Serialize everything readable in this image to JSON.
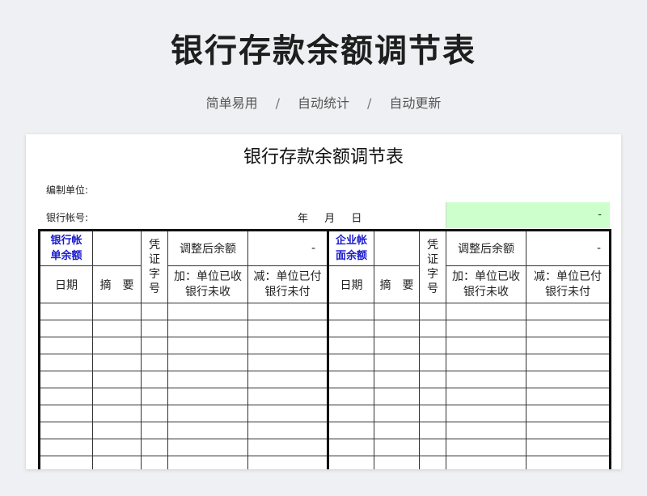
{
  "hero": {
    "title": "银行存款余额调节表",
    "tags": [
      "简单易用",
      "自动统计",
      "自动更新"
    ],
    "separator": "/"
  },
  "sheet": {
    "title": "银行存款余额调节表",
    "org_label": "编制单位:",
    "account_label": "银行帐号:",
    "date": {
      "year": "年",
      "month": "月",
      "day": "日"
    },
    "green_value": "-",
    "green_color": "#ccffcc"
  },
  "left_header": {
    "balance_label_line1": "银行帐",
    "balance_label_line2": "单余额",
    "voucher_chars": [
      "凭",
      "证",
      "字",
      "号"
    ],
    "adjusted_label": "调整后余额",
    "adjusted_value": "-",
    "date_col": "日期",
    "summary_col": "摘　要",
    "add_line1": "加：单位已收",
    "add_line2": "银行未收",
    "sub_line1": "减：单位已付",
    "sub_line2": "银行未付"
  },
  "right_header": {
    "balance_label_line1": "企业帐",
    "balance_label_line2": "面余额",
    "voucher_chars": [
      "凭",
      "证",
      "字",
      "号"
    ],
    "adjusted_label": "调整后余额",
    "adjusted_value": "-",
    "date_col": "日期",
    "summary_col": "摘　要",
    "add_line1": "加：单位已收",
    "add_line2": "银行未收",
    "sub_line1": "减：单位已付",
    "sub_line2": "银行未付"
  },
  "accent_blue": "#1a1acc"
}
